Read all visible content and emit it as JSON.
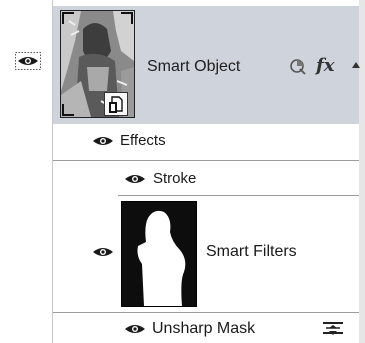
{
  "layer": {
    "name": "Smart Object",
    "fx_label": "fx"
  },
  "effects": {
    "label": "Effects",
    "items": [
      {
        "label": "Stroke"
      }
    ]
  },
  "smart_filters": {
    "label": "Smart Filters",
    "items": [
      {
        "label": "Unsharp Mask"
      }
    ]
  },
  "icons": {
    "visibility": "eye-icon",
    "smart_object_badge": "smart-object-badge-icon",
    "smart_filter_indicator": "smart-filter-icon",
    "fx": "fx-icon",
    "collapse": "triangle-up-icon",
    "filter_blending_options": "filter-blending-options-icon"
  },
  "colors": {
    "selected_row": "#cfd3dc",
    "separator": "#9c9c9c"
  }
}
